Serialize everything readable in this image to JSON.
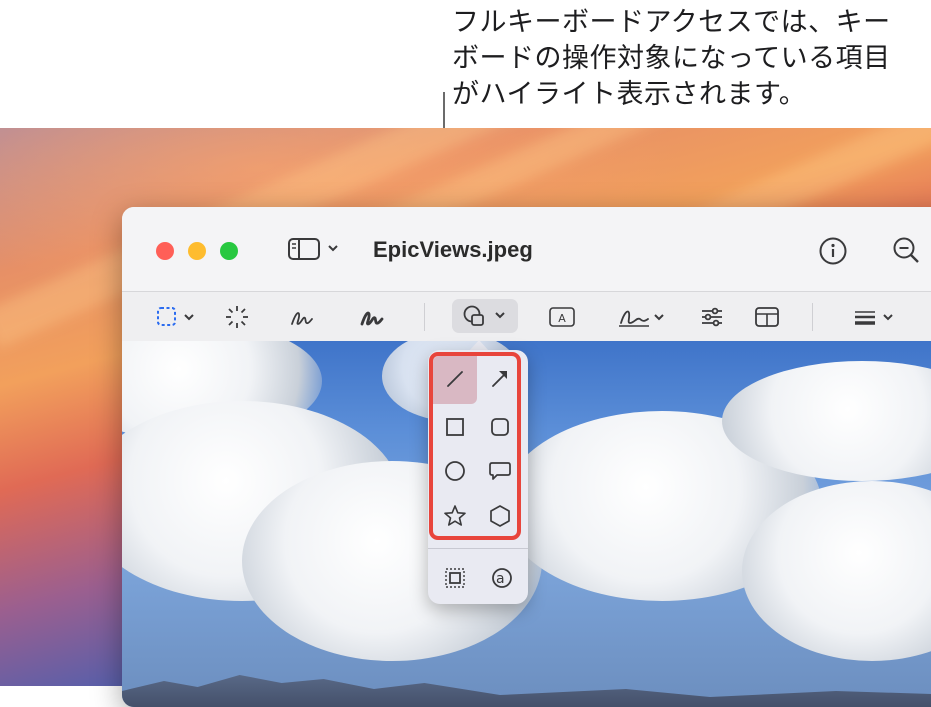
{
  "callout": {
    "text": "フルキーボードアクセスでは、キー\nボードの操作対象になっている項目\nがハイライト表示されます。"
  },
  "window": {
    "title": "EpicViews.jpeg",
    "traffic_lights": [
      "#ff5f57",
      "#febc2e",
      "#28c840"
    ]
  },
  "toolbar": {
    "buttons": [
      "rect-selection",
      "instant-alpha",
      "sketch",
      "draw",
      "shapes",
      "text",
      "sign",
      "adjust-color",
      "page-layout",
      "line-style"
    ]
  },
  "popover": {
    "shapes": [
      "line",
      "arrow",
      "rectangle",
      "rounded-rectangle",
      "oval",
      "speech-bubble",
      "star",
      "hexagon"
    ],
    "extras": [
      "mask",
      "loupe"
    ],
    "selected": "line"
  },
  "colors": {
    "focus_ring": "#e8453c",
    "selection": "#d9b8c3",
    "accent": "#2b6cf0"
  }
}
